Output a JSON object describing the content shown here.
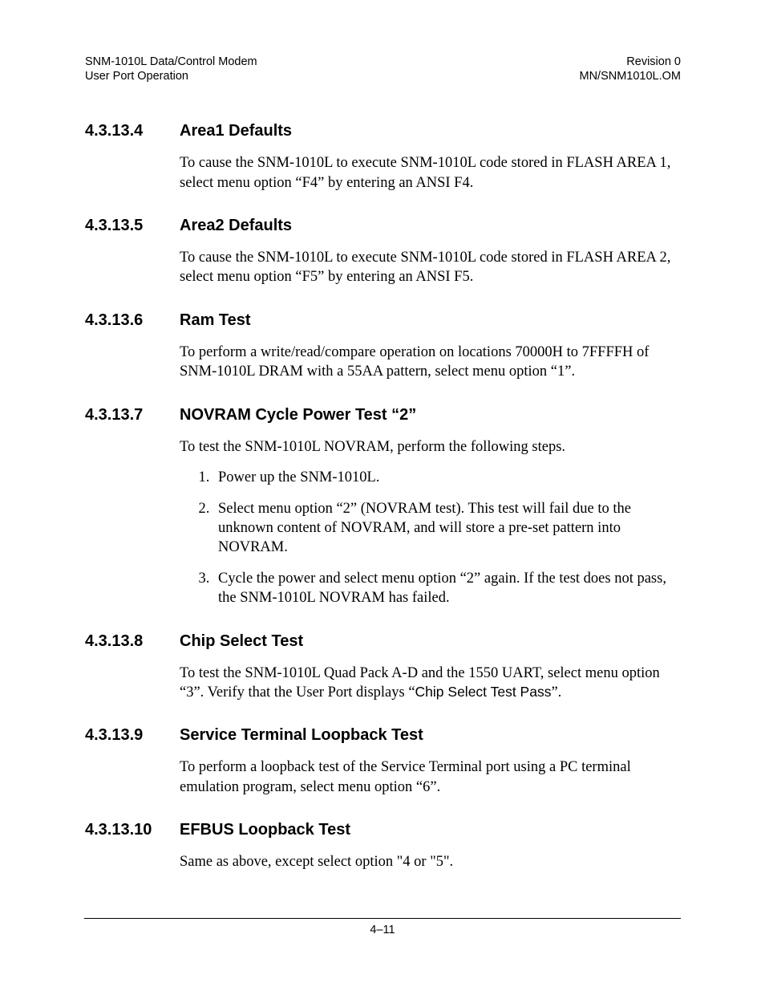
{
  "header": {
    "left_line1": "SNM-1010L Data/Control Modem",
    "left_line2": "User Port Operation",
    "right_line1": "Revision 0",
    "right_line2": "MN/SNM1010L.OM"
  },
  "sections": {
    "s4": {
      "num": "4.3.13.4",
      "title": "Area1 Defaults",
      "para1": "To cause the SNM-1010L to execute SNM-1010L code stored in FLASH AREA 1, select menu option “F4” by entering an ANSI F4."
    },
    "s5": {
      "num": "4.3.13.5",
      "title": "Area2 Defaults",
      "para1": "To cause the SNM-1010L to execute SNM-1010L code stored in FLASH AREA 2, select menu option “F5” by entering an ANSI F5."
    },
    "s6": {
      "num": "4.3.13.6",
      "title": "Ram Test",
      "para1": "To perform a write/read/compare operation on locations 70000H to 7FFFFH of SNM-1010L DRAM with a 55AA pattern, select menu option “1”."
    },
    "s7": {
      "num": "4.3.13.7",
      "title": "NOVRAM Cycle Power Test “2”",
      "para1": "To test the SNM-1010L NOVRAM, perform the following steps.",
      "steps": {
        "i1": "Power up the SNM-1010L.",
        "i2": "Select menu option “2” (NOVRAM test). This test will fail due to the unknown content of NOVRAM, and will store a pre-set pattern into NOVRAM.",
        "i3": "Cycle the power and select menu option “2” again. If the test does not pass, the SNM-1010L  NOVRAM has failed."
      }
    },
    "s8": {
      "num": "4.3.13.8",
      "title": "Chip Select Test",
      "para1_a": "To test the SNM-1010L Quad Pack A-D and the 1550 UART, select menu option “3”. Verify that the User Port displays “",
      "para1_code": "Chip Select Test Pass",
      "para1_b": "”."
    },
    "s9": {
      "num": "4.3.13.9",
      "title": "Service Terminal Loopback Test",
      "para1": "To perform a loopback test of the Service Terminal port using a PC terminal emulation program, select menu option “6”."
    },
    "s10": {
      "num": "4.3.13.10",
      "title": "EFBUS Loopback Test",
      "para1": "Same as above, except select option \"4 or \"5\"."
    }
  },
  "footer": {
    "page": "4–11"
  }
}
